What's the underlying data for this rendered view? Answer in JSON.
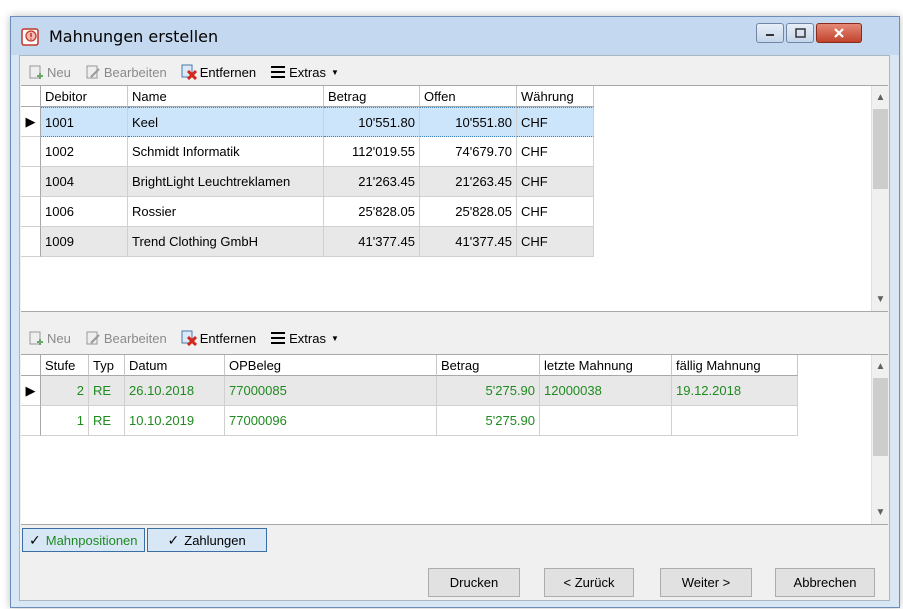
{
  "window": {
    "title": "Mahnungen erstellen"
  },
  "toolbar_top": {
    "new_label": "Neu",
    "edit_label": "Bearbeiten",
    "remove_label": "Entfernen",
    "extras_label": "Extras"
  },
  "grid_top": {
    "columns": [
      "Debitor",
      "Name",
      "Betrag",
      "Offen",
      "Währung"
    ],
    "rows": [
      [
        "1001",
        "Keel",
        "10'551.80",
        "10'551.80",
        "CHF"
      ],
      [
        "1002",
        "Schmidt Informatik",
        "112'019.55",
        "74'679.70",
        "CHF"
      ],
      [
        "1004",
        "BrightLight Leuchtreklamen",
        "21'263.45",
        "21'263.45",
        "CHF"
      ],
      [
        "1006",
        "Rossier",
        "25'828.05",
        "25'828.05",
        "CHF"
      ],
      [
        "1009",
        "Trend Clothing GmbH",
        "41'377.45",
        "41'377.45",
        "CHF"
      ]
    ]
  },
  "toolbar_bottom": {
    "new_label": "Neu",
    "edit_label": "Bearbeiten",
    "remove_label": "Entfernen",
    "extras_label": "Extras"
  },
  "grid_bottom": {
    "columns": [
      "Stufe",
      "Typ",
      "Datum",
      "OPBeleg",
      "Betrag",
      "letzte Mahnung",
      "fällig Mahnung"
    ],
    "rows": [
      [
        "2",
        "RE",
        "26.10.2018",
        "77000085",
        "5'275.90",
        "12000038",
        "19.12.2018"
      ],
      [
        "1",
        "RE",
        "10.10.2019",
        "77000096",
        "5'275.90",
        "",
        ""
      ]
    ]
  },
  "tabs": [
    {
      "label": "Mahnpositionen"
    },
    {
      "label": "Zahlungen"
    }
  ],
  "buttons": {
    "print": "Drucken",
    "back": "< Zurück",
    "next": "Weiter >",
    "cancel": "Abbrechen"
  },
  "colors": {
    "accent": "#3a6ea5",
    "selection": "#cde5fb",
    "green_text": "#1f8a1f"
  }
}
